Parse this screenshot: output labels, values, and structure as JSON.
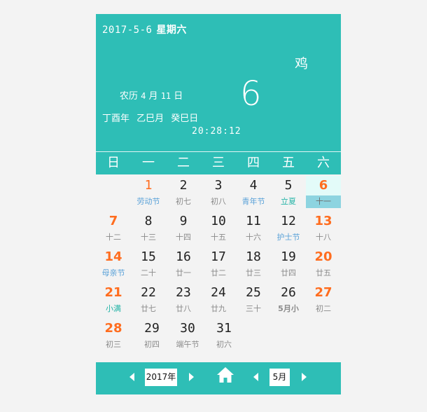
{
  "header": {
    "date_mono": "2017-5-6",
    "weekday": "星期六",
    "zodiac": "鸡",
    "big_day": "6",
    "lunar_label": "农历",
    "lunar_month": "4",
    "lunar_month_unit": "月",
    "lunar_day": "11",
    "lunar_day_unit": "日",
    "ganzhi": "丁酉年 乙巳月 癸巳日",
    "time": "20:28:12"
  },
  "weekdays": [
    "日",
    "一",
    "二",
    "三",
    "四",
    "五",
    "六"
  ],
  "days": [
    {
      "num": "1",
      "sub": "劳动节"
    },
    {
      "num": "2",
      "sub": "初七"
    },
    {
      "num": "3",
      "sub": "初八"
    },
    {
      "num": "4",
      "sub": "青年节"
    },
    {
      "num": "5",
      "sub": "立夏"
    },
    {
      "num": "6",
      "sub": "十一"
    },
    {
      "num": "7",
      "sub": "十二"
    },
    {
      "num": "8",
      "sub": "十三"
    },
    {
      "num": "9",
      "sub": "十四"
    },
    {
      "num": "10",
      "sub": "十五"
    },
    {
      "num": "11",
      "sub": "十六"
    },
    {
      "num": "12",
      "sub": "护士节"
    },
    {
      "num": "13",
      "sub": "十八"
    },
    {
      "num": "14",
      "sub": "母亲节"
    },
    {
      "num": "15",
      "sub": "二十"
    },
    {
      "num": "16",
      "sub": "廿一"
    },
    {
      "num": "17",
      "sub": "廿二"
    },
    {
      "num": "18",
      "sub": "廿三"
    },
    {
      "num": "19",
      "sub": "廿四"
    },
    {
      "num": "20",
      "sub": "廿五"
    },
    {
      "num": "21",
      "sub": "小满"
    },
    {
      "num": "22",
      "sub": "廿七"
    },
    {
      "num": "23",
      "sub": "廿八"
    },
    {
      "num": "24",
      "sub": "廿九"
    },
    {
      "num": "25",
      "sub": "三十"
    },
    {
      "num": "26",
      "sub": "5月小"
    },
    {
      "num": "27",
      "sub": "初二"
    },
    {
      "num": "28",
      "sub": "初三"
    },
    {
      "num": "29",
      "sub": "初四"
    },
    {
      "num": "30",
      "sub": "端午节"
    },
    {
      "num": "31",
      "sub": "初六"
    }
  ],
  "footer": {
    "year_value": "2017年",
    "month_value": "5月"
  },
  "colors": {
    "accent": "#2ebeb6",
    "weekend": "#ff6d1f",
    "festival": "#5aa2d8",
    "solar_term": "#22b3a6",
    "today_bg": "#e3fbf9",
    "today_sub_bg": "#8dd4e0"
  }
}
